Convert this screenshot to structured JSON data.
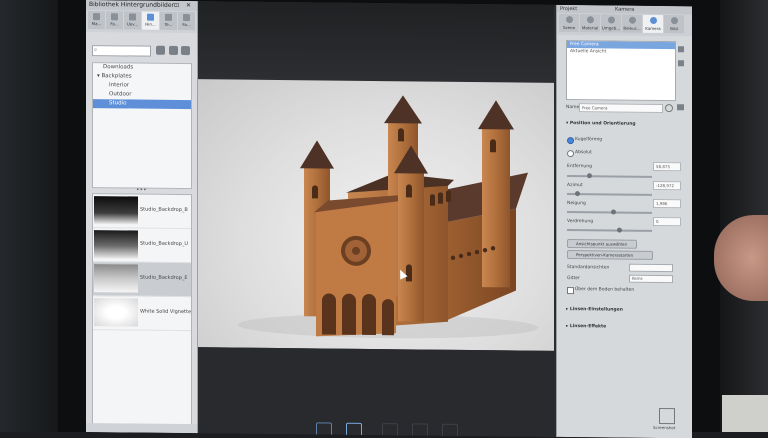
{
  "left_panel": {
    "title": "Bibliothek  Hintergrundbilder",
    "tabs": [
      "Ma...",
      "Fa...",
      "Uev...",
      "Hin...",
      "Te...",
      "Fa..."
    ],
    "tree": [
      "Downloads",
      "Backplates",
      "Interior",
      "Outdoor",
      "Studio"
    ],
    "thumbnails": [
      "Studio_Backdrop_B",
      "Studio_Backdrop_U",
      "Studio_Backdrop_E",
      "White Solid Vignette"
    ]
  },
  "right_panel": {
    "title_left": "Projekt",
    "title_center": "Kamera",
    "tabs": [
      "Szene",
      "Material",
      "Umgeb...",
      "Beleuc...",
      "Kamera",
      "Bild"
    ],
    "cameras": [
      "Free Camera",
      "Aktuelle Ansicht"
    ],
    "name_label": "Name",
    "name_value": "Free Camera",
    "section_position": "Position und Orientierung",
    "radio_orbit": "Kugelförmig",
    "radio_absolute": "Absolut",
    "field_distance": "Entfernung",
    "distance_value": "58,875",
    "field_azimuth": "Azimut",
    "azimuth_value": "-128,972",
    "field_incline": "Neigung",
    "incline_value": "1,986",
    "field_roll": "Verdrehung",
    "roll_value": "0",
    "btn_lookat": "Ansichtspunkt auswählen",
    "btn_perspective": "Perspektiven-Kamerastarten",
    "label_standard": "Standardansichten",
    "label_fov": "Gitter",
    "fov_value": "Keins",
    "checkbox_label": "Über dem Boden behalten",
    "section_lens": "Linsen-Einstellungen",
    "section_effects": "Linsen-Effekte",
    "corner_label": "Screenshot"
  },
  "colors": {
    "selection": "#5e8fd8",
    "wood": "#b0703c",
    "roof": "#5a3a2c",
    "studio_bg": "#e4e4e4"
  }
}
